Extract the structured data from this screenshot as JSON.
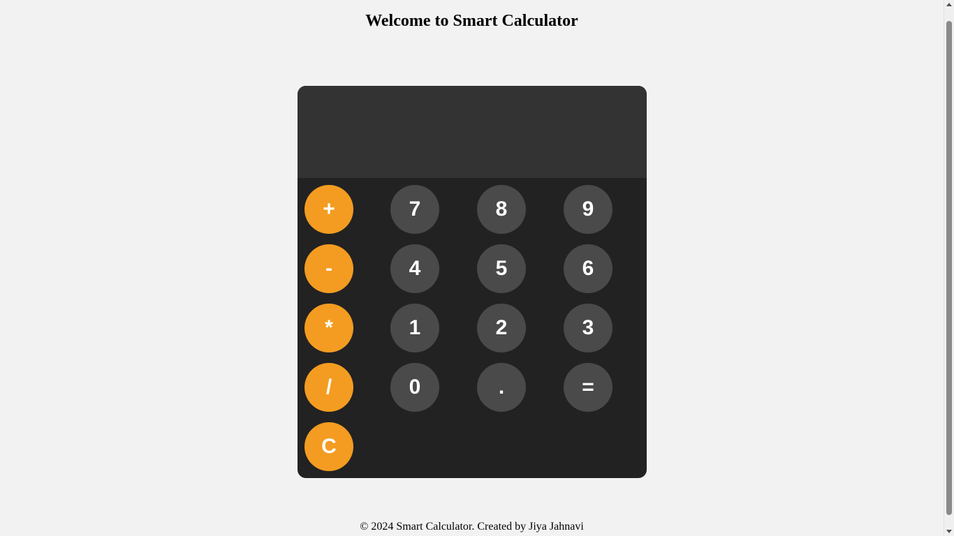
{
  "header": {
    "title": "Welcome to Smart Calculator"
  },
  "calculator": {
    "display_value": "",
    "keys": {
      "plus": "+",
      "minus": "-",
      "multiply": "*",
      "divide": "/",
      "clear": "C",
      "seven": "7",
      "eight": "8",
      "nine": "9",
      "four": "4",
      "five": "5",
      "six": "6",
      "one": "1",
      "two": "2",
      "three": "3",
      "zero": "0",
      "decimal": ".",
      "equals": "="
    }
  },
  "footer": {
    "text": "© 2024 Smart Calculator. Created by Jiya Jahnavi"
  },
  "colors": {
    "operator_key": "#f39c21",
    "number_key": "#4a4a4a",
    "calculator_body": "#222222",
    "display_background": "#333333",
    "page_background": "#f2f2f2"
  }
}
